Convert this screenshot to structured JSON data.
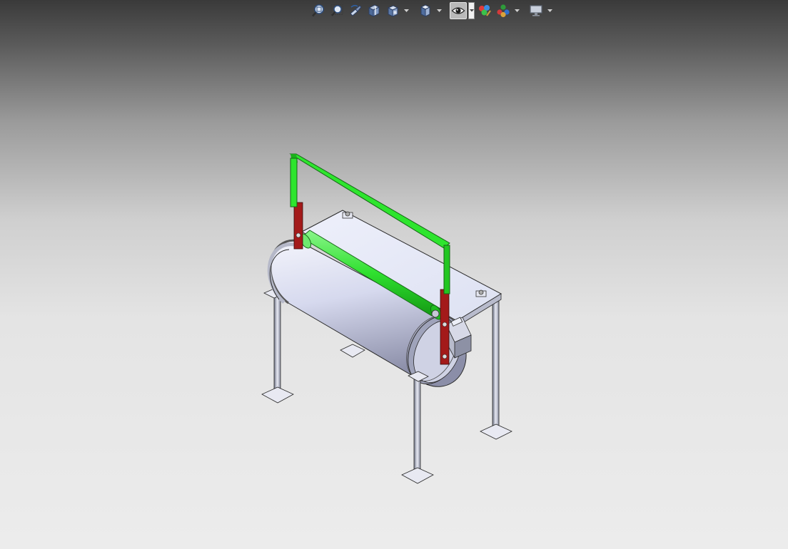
{
  "app": {
    "title": ""
  },
  "toolbar": {
    "tools": [
      {
        "icon": "zoom-to-fit-icon"
      },
      {
        "icon": "zoom-to-area-icon"
      },
      {
        "icon": "previous-view-icon"
      },
      {
        "icon": "section-view-icon"
      },
      {
        "icon": "view-orientation-icon",
        "dropdown": true
      },
      {
        "icon": "display-style-icon",
        "dropdown": true
      },
      {
        "icon": "hide-show-items-icon",
        "dropdown": true,
        "active": true
      },
      {
        "icon": "edit-appearance-icon"
      },
      {
        "icon": "apply-scene-icon",
        "dropdown": true
      },
      {
        "icon": "view-settings-icon",
        "dropdown": true
      }
    ]
  },
  "model": {
    "description_colors": {
      "frame": "#2ee52e",
      "roller": "#33dd33",
      "bracket": "#a11b1b",
      "drum": "#d8dcf0",
      "legs": "#c8cad8"
    }
  }
}
